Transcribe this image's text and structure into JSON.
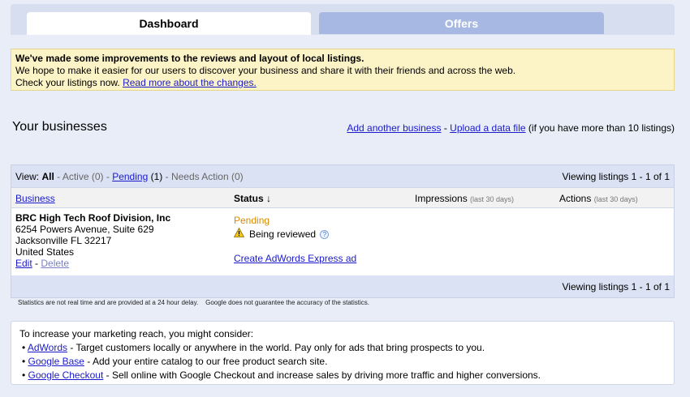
{
  "tabs": {
    "dashboard": "Dashboard",
    "offers": "Offers"
  },
  "notice": {
    "headline": "We've made some improvements to the reviews and layout of local listings.",
    "line2": "We hope to make it easier for our users to discover your business and share it with their friends and across the web.",
    "line3_prefix": "Check your listings now.",
    "link": "Read more about the changes."
  },
  "businesses": {
    "title": "Your businesses",
    "add_link": "Add another business",
    "sep": "-",
    "upload_link": "Upload a data file",
    "upload_note": "(if you have more than 10 listings)"
  },
  "view_bar": {
    "view_label": "View:",
    "all": "All",
    "active": "- Active (0) -",
    "pending_link": "Pending",
    "pending_count": "(1)",
    "needs_action": "- Needs Action (0)",
    "viewing": "Viewing listings 1 - 1 of 1"
  },
  "columns": {
    "business": "Business",
    "status": "Status ↓",
    "impressions": "Impressions",
    "impressions_note": "(last 30 days)",
    "actions": "Actions",
    "actions_note": "(last 30 days)"
  },
  "listing": {
    "name": "BRC High Tech Roof Division, Inc",
    "address1": "6254 Powers Avenue, Suite 629",
    "address2": "Jacksonville FL 32217",
    "country": "United States",
    "edit": "Edit",
    "sep": "-",
    "delete": "Delete",
    "status": "Pending",
    "review": "Being reviewed",
    "adwords": "Create AdWords Express ad"
  },
  "footer_bar": {
    "viewing": "Viewing listings 1 - 1 of 1"
  },
  "stats_note": "Statistics are not real time and are provided at a 24 hour delay.    Google does not guarantee the accuracy of the statistics.",
  "reach": {
    "intro": "To increase your marketing reach, you might consider:",
    "items": [
      {
        "link": "AdWords",
        "text": " - Target customers locally or anywhere in the world. Pay only for ads that bring prospects to you."
      },
      {
        "link": "Google Base",
        "text": " - Add your entire catalog to our free product search site."
      },
      {
        "link": "Google Checkout",
        "text": " - Sell online with Google Checkout and increase sales by driving more traffic and higher conversions."
      }
    ]
  },
  "icons": {
    "warning": "warning-icon",
    "help": "help-icon"
  },
  "colors": {
    "pending": "#d88b00",
    "link": "#1a1acc",
    "notice_bg": "#fcf3c6"
  }
}
